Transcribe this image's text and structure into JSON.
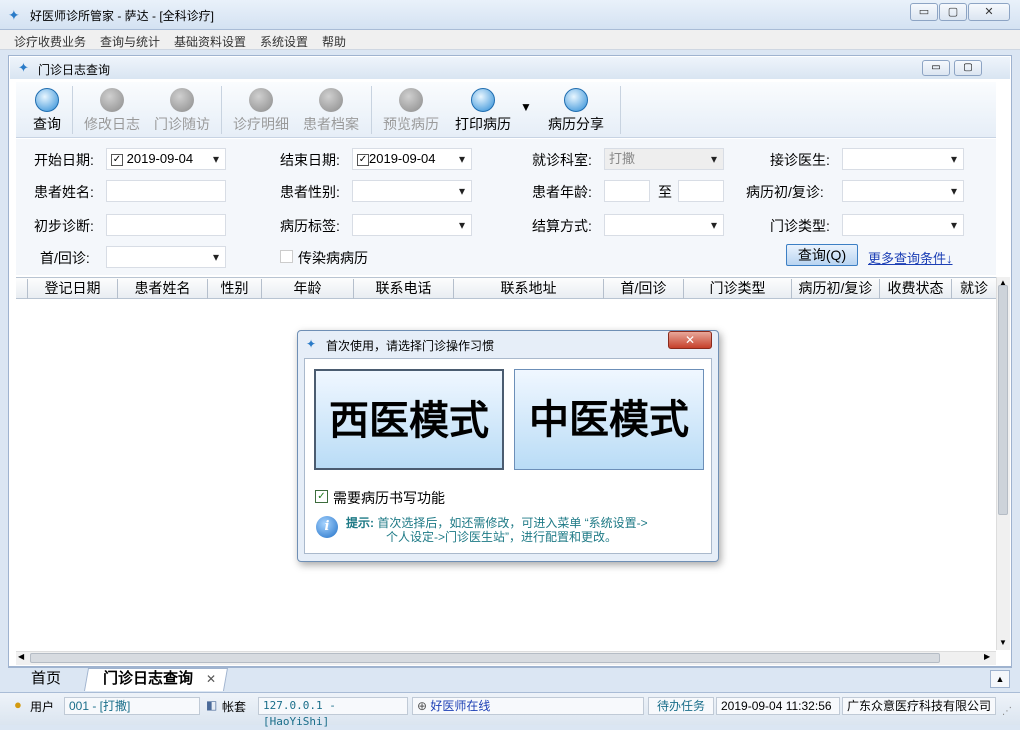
{
  "window": {
    "title": "好医师诊所管家 - 萨达 - [全科诊疗]",
    "min": "▭",
    "max": "▢",
    "close": "✕"
  },
  "menu": [
    "诊疗收费业务",
    "查询与统计",
    "基础资料设置",
    "系统设置",
    "帮助"
  ],
  "child": {
    "title": "门诊日志查询",
    "min": "▭",
    "max": "▢"
  },
  "toolbar": [
    {
      "label": "查询",
      "enabled": true
    },
    {
      "label": "修改日志",
      "enabled": false
    },
    {
      "label": "门诊随访",
      "enabled": false
    },
    {
      "label": "诊疗明细",
      "enabled": false
    },
    {
      "label": "患者档案",
      "enabled": false
    },
    {
      "label": "预览病历",
      "enabled": false
    },
    {
      "label": "打印病历",
      "enabled": true
    },
    {
      "label": "病历分享",
      "enabled": true
    }
  ],
  "form": {
    "start_date_label": "开始日期:",
    "start_date": "2019-09-04",
    "end_date_label": "结束日期:",
    "end_date": "2019-09-04",
    "dept_label": "就诊科室:",
    "dept": "打撒",
    "doctor_label": "接诊医生:",
    "name_label": "患者姓名:",
    "gender_label": "患者性别:",
    "age_label": "患者年龄:",
    "age_to": "至",
    "visit_type_label": "病历初/复诊:",
    "diagnosis_label": "初步诊断:",
    "tag_label": "病历标签:",
    "settle_label": "结算方式:",
    "clinic_type_label": "门诊类型:",
    "first_return_label": "首/回诊:",
    "infectious_label": "传染病病历",
    "query_button": "查询(Q)",
    "more_link": "更多查询条件↓"
  },
  "table": {
    "columns": [
      "登记日期",
      "患者姓名",
      "性别",
      "年龄",
      "联系电话",
      "联系地址",
      "首/回诊",
      "门诊类型",
      "病历初/复诊",
      "收费状态",
      "就诊"
    ]
  },
  "tabs": {
    "home": "首页",
    "active": "门诊日志查询",
    "close": "✕"
  },
  "status": {
    "user_label": "用户",
    "user": "001 - [打撒]",
    "account_label": "帐套",
    "server": "127.0.0.1 - [HaoYiShi]",
    "online": "好医师在线",
    "todo": "待办任务",
    "datetime": "2019-09-04 11:32:56",
    "company": "广东众意医疗科技有限公司"
  },
  "dialog": {
    "title": "首次使用，请选择门诊操作习惯",
    "close": "✕",
    "west": "西医模式",
    "east": "中医模式",
    "need_writing": "需要病历书写功能",
    "hint_label": "提示:",
    "hint_line1": "首次选择后，如还需修改，可进入菜单 “系统设置->",
    "hint_line2": "个人设定->门诊医生站”，进行配置和更改。"
  }
}
